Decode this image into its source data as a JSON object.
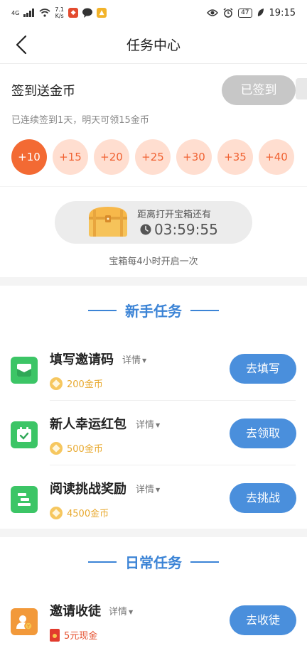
{
  "status_bar": {
    "network": "4G",
    "speed_value": "7.1",
    "speed_unit": "K/s",
    "battery": "47",
    "time": "19:15"
  },
  "header": {
    "title": "任务中心"
  },
  "signin": {
    "title": "签到送金币",
    "button": "已签到",
    "subtitle": "已连续签到1天，明天可领15金币",
    "rewards": [
      "+10",
      "+15",
      "+20",
      "+25",
      "+30",
      "+35",
      "+40"
    ],
    "active_index": 0
  },
  "chest": {
    "label": "距离打开宝箱还有",
    "timer": "03:59:55",
    "note": "宝箱每4小时开启一次"
  },
  "newbie": {
    "title": "新手任务",
    "tasks": [
      {
        "name": "填写邀请码",
        "detail": "详情",
        "reward": "200金币",
        "button": "去填写"
      },
      {
        "name": "新人幸运红包",
        "detail": "详情",
        "reward": "500金币",
        "button": "去领取"
      },
      {
        "name": "阅读挑战奖励",
        "detail": "详情",
        "reward": "4500金币",
        "button": "去挑战"
      }
    ]
  },
  "daily": {
    "title": "日常任务",
    "tasks": [
      {
        "name": "邀请收徒",
        "detail": "详情",
        "reward": "5元现金",
        "button": "去收徒"
      }
    ]
  },
  "colors": {
    "accent_blue": "#3c84d6",
    "button_blue": "#4a8fdc",
    "orange": "#f36a33",
    "coin_gold": "#f6c75f",
    "task_green": "#3cc566",
    "task_orange": "#f2993a"
  }
}
